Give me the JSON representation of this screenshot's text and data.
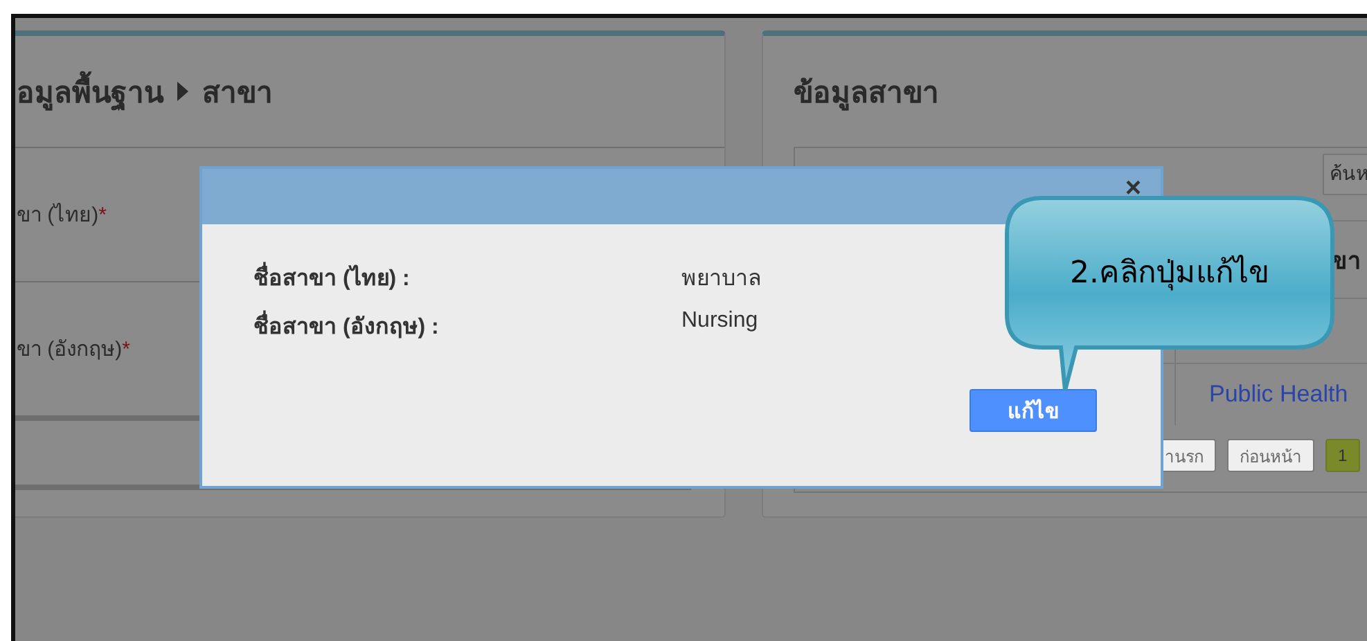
{
  "left_panel": {
    "title": "อมูลพื้นฐาน",
    "title_current": "สาขา",
    "fields": [
      {
        "label": "ขา (ไทย)",
        "mark": "*"
      },
      {
        "label": "ขา (อังกฤษ)",
        "mark": "*"
      }
    ]
  },
  "right_panel": {
    "title": "ข้อมูลสาขา",
    "search": {
      "placeholder": "ค้นห"
    },
    "table": {
      "columns": [
        "ขา"
      ],
      "rows": [
        [
          "Public Health"
        ]
      ]
    },
    "pagination": [
      {
        "label": "านรก",
        "selected": false
      },
      {
        "label": "ก่อนหน้า",
        "selected": false
      },
      {
        "label": "1",
        "selected": true
      }
    ]
  },
  "modal": {
    "close": "×",
    "fields": [
      {
        "label": "ชื่อสาขา (ไทย) :",
        "value": "พยาบาล"
      },
      {
        "label": "ชื่อสาขา (อังกฤษ) :",
        "value": "Nursing"
      }
    ],
    "button": "แก้ไข"
  },
  "callout": {
    "text": "2.คลิกปุ่มแก้ไข"
  }
}
